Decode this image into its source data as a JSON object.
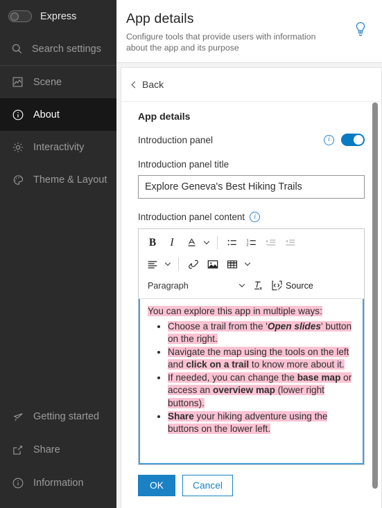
{
  "sidebar": {
    "express": {
      "label": "Express",
      "enabled": false
    },
    "search": {
      "label": "Search settings",
      "icon": "search-icon"
    },
    "items": [
      {
        "label": "Scene",
        "icon": "scene-icon",
        "active": false
      },
      {
        "label": "About",
        "icon": "info-circle-icon",
        "active": true
      },
      {
        "label": "Interactivity",
        "icon": "gear-icon",
        "active": false
      },
      {
        "label": "Theme & Layout",
        "icon": "palette-icon",
        "active": false
      }
    ],
    "bottom_items": [
      {
        "label": "Getting started",
        "icon": "megaphone-icon"
      },
      {
        "label": "Share",
        "icon": "share-icon"
      },
      {
        "label": "Information",
        "icon": "info-circle-icon"
      }
    ]
  },
  "header": {
    "title": "App details",
    "subtitle": "Configure tools that provide users with information about the app and its purpose",
    "hint_icon": "lightbulb-icon",
    "accent": "#2b83c6"
  },
  "panel": {
    "back_label": "Back",
    "section_title": "App details",
    "intro_panel": {
      "label": "Introduction panel",
      "info_icon": "info-circle-icon",
      "toggle_on": true
    },
    "intro_title": {
      "label": "Introduction panel title",
      "value": "Explore Geneva's Best Hiking Trails",
      "placeholder": "Introduction panel title"
    },
    "intro_content": {
      "label": "Introduction panel content",
      "info_icon": "info-circle-icon"
    }
  },
  "editor": {
    "toolbar": {
      "row1": [
        {
          "name": "bold-button",
          "glyph": "B",
          "kind": "bold",
          "disabled": false
        },
        {
          "name": "italic-button",
          "glyph": "I",
          "kind": "italic",
          "disabled": false
        },
        {
          "name": "font-color-button",
          "glyph": "A",
          "kind": "font-color",
          "disabled": false
        },
        {
          "name": "font-color-dropdown",
          "kind": "caret",
          "disabled": false
        },
        {
          "name": "separator",
          "kind": "sep"
        },
        {
          "name": "bulleted-list-button",
          "kind": "bullet-list",
          "disabled": false
        },
        {
          "name": "numbered-list-button",
          "kind": "number-list",
          "disabled": false
        },
        {
          "name": "increase-indent-button",
          "kind": "indent",
          "disabled": true
        },
        {
          "name": "decrease-indent-button",
          "kind": "outdent",
          "disabled": true
        }
      ],
      "row2": [
        {
          "name": "align-button",
          "kind": "align",
          "disabled": false
        },
        {
          "name": "align-dropdown",
          "kind": "caret",
          "disabled": false
        },
        {
          "name": "separator",
          "kind": "sep"
        },
        {
          "name": "link-button",
          "kind": "link",
          "disabled": false
        },
        {
          "name": "image-button",
          "kind": "image",
          "disabled": false
        },
        {
          "name": "table-button",
          "kind": "table",
          "disabled": false
        },
        {
          "name": "table-dropdown",
          "kind": "caret",
          "disabled": false
        }
      ],
      "paragraph_select": {
        "label": "Paragraph"
      },
      "remove_format_label": "",
      "source_label": "Source"
    },
    "content": {
      "intro": "You can explore this app in multiple ways:",
      "bullets": [
        [
          {
            "text": "Choose a trail from the '",
            "style": "plain"
          },
          {
            "text": "Open slides",
            "style": "bold-italic"
          },
          {
            "text": "' button on the right.",
            "style": "plain"
          }
        ],
        [
          {
            "text": "Navigate the map using the tools on the left and ",
            "style": "plain"
          },
          {
            "text": "click on a trail",
            "style": "bold"
          },
          {
            "text": " to know more about it.",
            "style": "plain"
          }
        ],
        [
          {
            "text": "If needed, you can change the ",
            "style": "plain"
          },
          {
            "text": "base map",
            "style": "bold"
          },
          {
            "text": " or access an ",
            "style": "plain"
          },
          {
            "text": "overview map",
            "style": "bold"
          },
          {
            "text": " (lower right buttons).",
            "style": "plain"
          }
        ],
        [
          {
            "text": "Share",
            "style": "bold"
          },
          {
            "text": " your hiking adventure using the buttons on the lower left.",
            "style": "plain"
          }
        ]
      ],
      "highlight_color": "#fbc2d4"
    }
  },
  "actions": {
    "ok_label": "OK",
    "cancel_label": "Cancel",
    "primary_color": "#1a81c4"
  }
}
